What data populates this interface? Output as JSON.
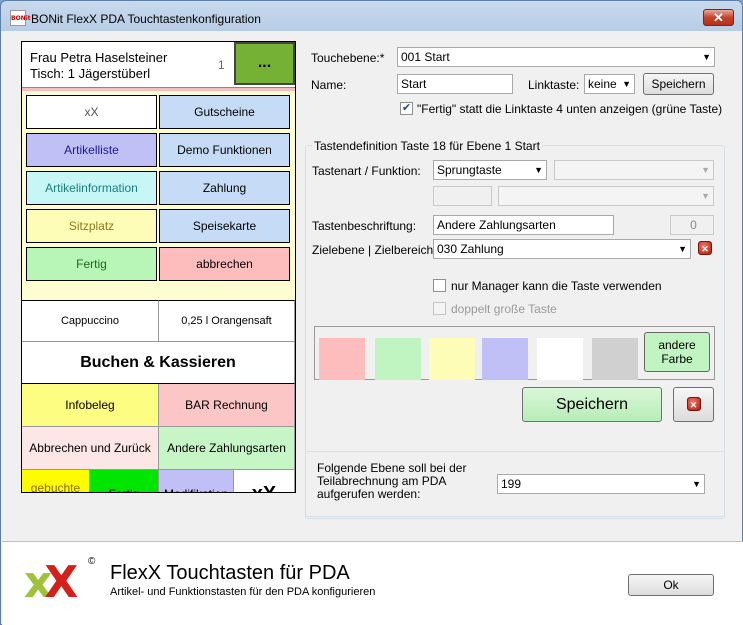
{
  "window": {
    "title": "BONit FlexX PDA Touchtastenkonfiguration",
    "icon_text": "BONit",
    "close": "✕"
  },
  "pda": {
    "guest": "Frau  Petra  Haselsteiner",
    "table": "Tisch: 1 Jägerstüberl",
    "page": "1",
    "menu_button": "...",
    "buttons": [
      {
        "label": "xX",
        "color": "#ffffff",
        "text_color": "#555555"
      },
      {
        "label": "Gutscheine",
        "color": "#c6dcf6",
        "text_color": "#000000"
      },
      {
        "label": "Artikelliste",
        "color": "#c0c0f6",
        "text_color": "#1a1a8c"
      },
      {
        "label": "Demo Funktionen",
        "color": "#c6dcf6",
        "text_color": "#000000"
      },
      {
        "label": "Artikelinformation",
        "color": "#c6f6f6",
        "text_color": "#1a8080"
      },
      {
        "label": "Zahlung",
        "color": "#c6dcf6",
        "text_color": "#000000"
      },
      {
        "label": "Sitzplatz",
        "color": "#fdfdb8",
        "text_color": "#8c7a1a"
      },
      {
        "label": "Speisekarte",
        "color": "#c6dcf6",
        "text_color": "#000000"
      },
      {
        "label": "Fertig",
        "color": "#b8f6b8",
        "text_color": "#1a6a1a"
      },
      {
        "label": "abbrechen",
        "color": "#fdbdbd",
        "text_color": "#000000"
      }
    ],
    "items": [
      "Cappuccino",
      "0,25 l Orangensaft"
    ],
    "book_label": "Buchen & Kassieren",
    "actions": [
      {
        "label": "Infobeleg",
        "color": "#fdfd82"
      },
      {
        "label": "BAR Rechnung",
        "color": "#fdc6c6"
      },
      {
        "label": "Abbrechen und Zurück",
        "color": "#fde6e6"
      },
      {
        "label": "Andere Zahlungsarten",
        "color": "#c6f6c6"
      }
    ],
    "bottom": [
      {
        "label": "gebuchte Artikel",
        "color": "#fdfd00"
      },
      {
        "label": "Fertig",
        "color": "#00e600"
      },
      {
        "label": "Modifikation",
        "color": "#c0c0f6"
      },
      {
        "label": "xX",
        "color": "#ffffff"
      }
    ]
  },
  "form": {
    "touchebene_label": "Touchebene:*",
    "touchebene_value": "001 Start",
    "name_label": "Name:",
    "name_value": "Start",
    "linktaste_label": "Linktaste:",
    "linktaste_value": "keine",
    "save_small": "Speichern",
    "fertig_checkbox": "\"Fertig\" statt die Linktaste 4 unten anzeigen (grüne Taste)",
    "group_title": "Tastendefinition Taste 18 für Ebene 1 Start",
    "tastenart_label": "Tastenart / Funktion:",
    "tastenart_value": "Sprungtaste",
    "beschriftung_label": "Tastenbeschriftung:",
    "beschriftung_value": "Andere Zahlungsarten",
    "counter_value": "0",
    "zielebene_label": "Zielebene | Zielbereich:",
    "zielebene_value": "030 Zahlung",
    "manager_checkbox": "nur Manager kann die Taste verwenden",
    "double_checkbox": "doppelt große Taste",
    "swatches": [
      "#fdbdbd",
      "#c0f4c0",
      "#fdfdb8",
      "#c0c0f6",
      "#ffffff",
      "#d0d0d0"
    ],
    "andere_farbe": "andere Farbe",
    "save_big": "Speichern",
    "teilabrechnung_label": "Folgende Ebene soll bei der Teilabrechnung am PDA aufgerufen werden:",
    "teilabrechnung_value": "199"
  },
  "footer": {
    "title": "FlexX Touchtasten für PDA",
    "subtitle": "Artikel- und Funktionstasten für den PDA konfigurieren",
    "copyright": "©",
    "ok": "Ok"
  }
}
